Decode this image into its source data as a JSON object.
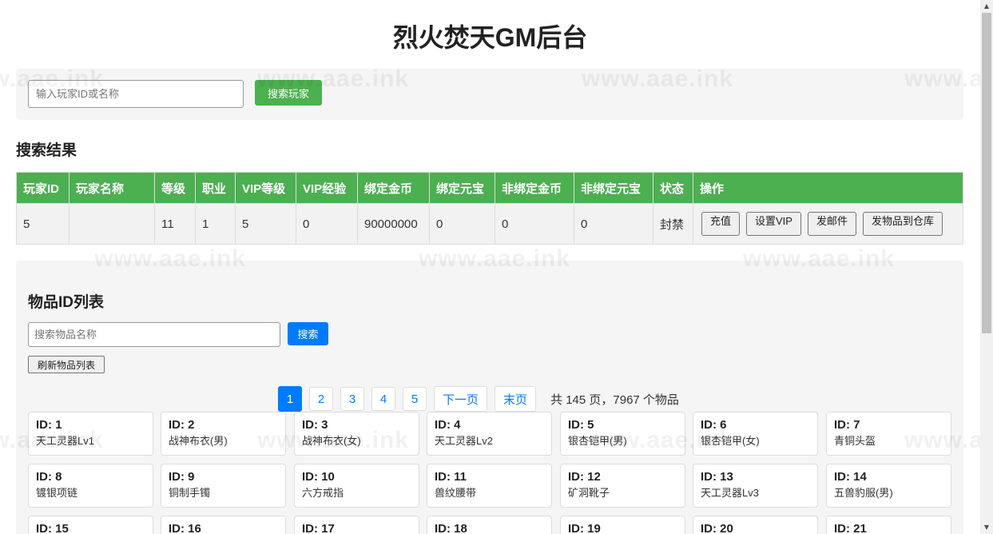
{
  "app": {
    "title": "烈火焚天GM后台",
    "watermark_text": "www.aae.ink"
  },
  "player_search": {
    "placeholder": "输入玩家ID或名称",
    "value": "",
    "button_label": "搜索玩家"
  },
  "results": {
    "heading": "搜索结果",
    "columns": [
      "玩家ID",
      "玩家名称",
      "等级",
      "职业",
      "VIP等级",
      "VIP经验",
      "绑定金币",
      "绑定元宝",
      "非绑定金币",
      "非绑定元宝",
      "状态",
      "操作"
    ],
    "rows": [
      {
        "player_id": "5",
        "player_name": "",
        "level": "11",
        "class": "1",
        "vip_level": "5",
        "vip_exp": "0",
        "bound_gold": "90000000",
        "bound_yuanbao": "0",
        "unbound_gold": "0",
        "unbound_yuanbao": "0",
        "status": "封禁",
        "actions": [
          "充值",
          "设置VIP",
          "发邮件",
          "发物品到仓库"
        ]
      }
    ]
  },
  "items": {
    "heading": "物品ID列表",
    "search_placeholder": "搜索物品名称",
    "search_button": "搜索",
    "refresh_button": "刷新物品列表",
    "pagination": {
      "pages": [
        "1",
        "2",
        "3",
        "4",
        "5"
      ],
      "current": "1",
      "next_label": "下一页",
      "last_label": "末页",
      "info": "共 145 页，7967 个物品"
    },
    "list": [
      {
        "id": "ID: 1",
        "name": "天工灵器Lv1"
      },
      {
        "id": "ID: 2",
        "name": "战神布衣(男)"
      },
      {
        "id": "ID: 3",
        "name": "战神布衣(女)"
      },
      {
        "id": "ID: 4",
        "name": "天工灵器Lv2"
      },
      {
        "id": "ID: 5",
        "name": "银杏铠甲(男)"
      },
      {
        "id": "ID: 6",
        "name": "银杏铠甲(女)"
      },
      {
        "id": "ID: 7",
        "name": "青铜头盔"
      },
      {
        "id": "ID: 8",
        "name": "镀银项链"
      },
      {
        "id": "ID: 9",
        "name": "铜制手镯"
      },
      {
        "id": "ID: 10",
        "name": "六方戒指"
      },
      {
        "id": "ID: 11",
        "name": "兽纹腰带"
      },
      {
        "id": "ID: 12",
        "name": "矿洞靴子"
      },
      {
        "id": "ID: 13",
        "name": "天工灵器Lv3"
      },
      {
        "id": "ID: 14",
        "name": "五兽豹服(男)"
      },
      {
        "id": "ID: 15",
        "name": ""
      },
      {
        "id": "ID: 16",
        "name": ""
      },
      {
        "id": "ID: 17",
        "name": ""
      },
      {
        "id": "ID: 18",
        "name": ""
      },
      {
        "id": "ID: 19",
        "name": ""
      },
      {
        "id": "ID: 20",
        "name": ""
      },
      {
        "id": "ID: 21",
        "name": ""
      }
    ]
  },
  "theme": {
    "accent_green": "#4caf50",
    "accent_blue": "#007bff",
    "panel_bg": "#f5f5f5"
  }
}
